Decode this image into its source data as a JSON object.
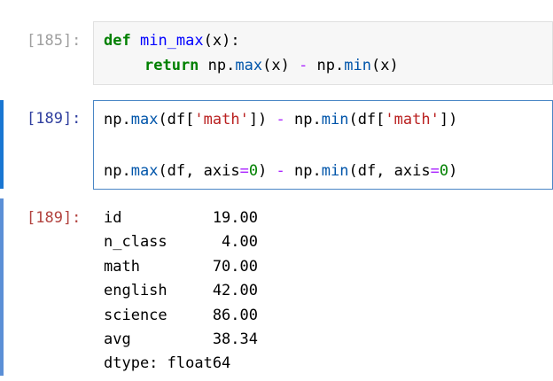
{
  "cells": [
    {
      "prompt": "[185]:",
      "code": {
        "line1": {
          "def": "def",
          "name": "min_max",
          "args": "(x):"
        },
        "line2": {
          "ret": "return",
          "a": "np.",
          "b": "max",
          "c": "(x) ",
          "minus": "-",
          "d": " np.",
          "e": "min",
          "f": "(x)"
        }
      }
    },
    {
      "prompt": "[189]:",
      "code": {
        "line1": {
          "a": "np.",
          "b": "max",
          "c": "(df[",
          "s1": "'math'",
          "d": "]) ",
          "minus": "-",
          "e": " np.",
          "f": "min",
          "g": "(df[",
          "s2": "'math'",
          "h": "])"
        },
        "line2": {
          "a": "np.",
          "b": "max",
          "c": "(df, axis",
          "eq": "=",
          "zero": "0",
          "d": ") ",
          "minus": "-",
          "e": " np.",
          "f": "min",
          "g": "(df, axis",
          "eq2": "=",
          "zero2": "0",
          "h": ")"
        }
      },
      "output_prompt": "[189]:",
      "output_lines": [
        "id          19.00",
        "n_class      4.00",
        "math        70.00",
        "english     42.00",
        "science     86.00",
        "avg         38.34",
        "dtype: float64"
      ]
    }
  ]
}
